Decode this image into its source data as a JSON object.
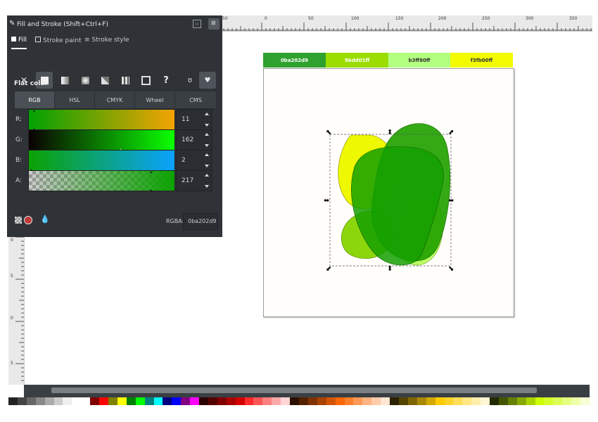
{
  "panel": {
    "title": "Fill and Stroke (Shift+Ctrl+F)",
    "tabs": [
      "Fill",
      "Stroke paint",
      "Stroke style"
    ],
    "section_label": "Flat color",
    "modes": [
      "RGB",
      "HSL",
      "CMYK",
      "Wheel",
      "CMS"
    ],
    "channels": [
      {
        "label": "R:",
        "value": "11"
      },
      {
        "label": "G:",
        "value": "162"
      },
      {
        "label": "B:",
        "value": "2"
      },
      {
        "label": "A:",
        "value": "217"
      }
    ],
    "rgba_label": "RGBA:",
    "rgba_value": "0ba202d9"
  },
  "ruler_top": [
    "50",
    "0",
    "50",
    "100",
    "150",
    "200",
    "250",
    "300",
    "350"
  ],
  "ruler_left": [
    "0",
    "5",
    "0",
    "5"
  ],
  "swatches": [
    {
      "label": "0ba202d9",
      "bg": "#2fa12f",
      "fg": "#ffffff"
    },
    {
      "label": "9bdd01ff",
      "bg": "#9bdd01",
      "fg": "#ffffff"
    },
    {
      "label": "b3ff80ff",
      "bg": "#b3ff80",
      "fg": "#333333"
    },
    {
      "label": "f3fb00ff",
      "bg": "#f3fb00",
      "fg": "#333333"
    }
  ]
}
